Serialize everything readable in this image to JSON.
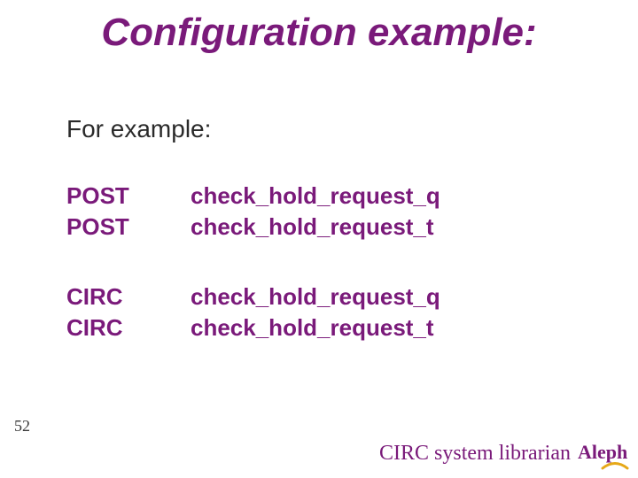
{
  "title": "Configuration example:",
  "subtitle": "For example:",
  "group1": {
    "rows": [
      {
        "key": "POST",
        "val": "check_hold_request_q"
      },
      {
        "key": "POST",
        "val": "check_hold_request_t"
      }
    ]
  },
  "group2": {
    "rows": [
      {
        "key": "CIRC",
        "val": "check_hold_request_q"
      },
      {
        "key": "CIRC",
        "val": "check_hold_request_t"
      }
    ]
  },
  "page_number": "52",
  "footer": "CIRC system librarian",
  "logo_text": "Aleph"
}
